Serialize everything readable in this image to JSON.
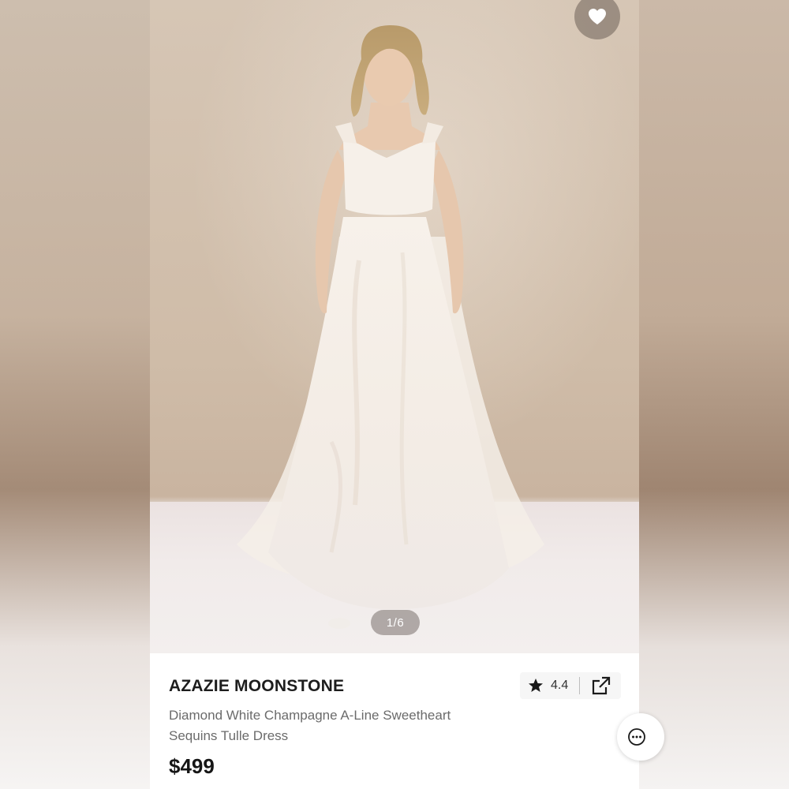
{
  "product": {
    "brand": "AZAZIE MOONSTONE",
    "description_line1": "Diamond White Champagne A-Line Sweetheart",
    "description_line2": "Sequins Tulle Dress",
    "price": "$499",
    "rating": "4.4"
  },
  "gallery": {
    "counter": "1/6"
  },
  "icons": {
    "favorite": "heart-icon",
    "rating": "star-icon",
    "share": "external-link-icon",
    "chat": "chat-bubble-icon"
  },
  "colors": {
    "favorite_button_bg": "#6e6058",
    "text_primary": "#1d1d1d",
    "text_secondary": "#6b6b6b"
  }
}
